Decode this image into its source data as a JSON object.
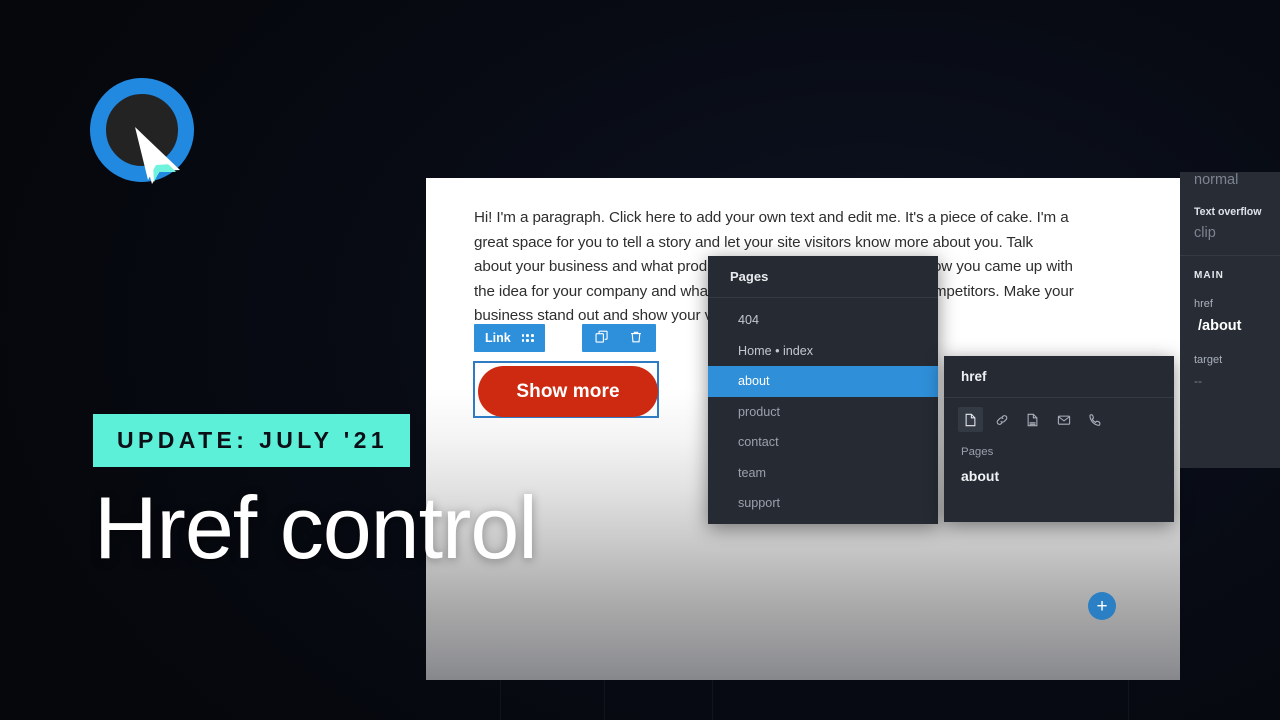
{
  "logo": {
    "name": "editor-x-logo"
  },
  "lower_third": {
    "badge": "UPDATE: JULY '21",
    "title": "Href control"
  },
  "canvas": {
    "paragraph": "Hi! I'm a paragraph. Click here to add your own text and edit me. It's a piece of cake. I'm a great space for you to tell a story and let your site visitors know more about you. Talk about your business and what products or services you offer. Share how you came up with the idea for your company and what makes you different from your competitors. Make your business stand out and show your visitors who you are.",
    "toolbar": {
      "link_label": "Link",
      "drag_handle": "drag-handle-icon",
      "duplicate_icon": "duplicate-icon",
      "delete_icon": "trash-icon"
    },
    "button": {
      "label": "Show more"
    },
    "add_button": {
      "label": "+"
    }
  },
  "pages_panel": {
    "title": "Pages",
    "items": [
      {
        "label": "404",
        "selected": false
      },
      {
        "label": "Home • index",
        "selected": false
      },
      {
        "label": "about",
        "selected": true
      },
      {
        "label": "product",
        "selected": false
      },
      {
        "label": "contact",
        "selected": false
      },
      {
        "label": "team",
        "selected": false
      },
      {
        "label": "support",
        "selected": false
      }
    ]
  },
  "href_panel": {
    "title": "href",
    "icons": [
      {
        "name": "page-icon",
        "active": true
      },
      {
        "name": "link-icon",
        "active": false
      },
      {
        "name": "file-download-icon",
        "active": false
      },
      {
        "name": "email-icon",
        "active": false
      },
      {
        "name": "phone-icon",
        "active": false
      }
    ],
    "field_label": "Pages",
    "field_value": "about"
  },
  "sidebar": {
    "white_space_value": "normal",
    "text_overflow_label": "Text overflow",
    "text_overflow_value": "clip",
    "section_title": "MAIN",
    "href_label": "href",
    "href_value": "/about",
    "target_label": "target",
    "target_value": "--"
  },
  "colors": {
    "background": "#080b14",
    "accent_blue": "#2f8fd8",
    "accent_mint": "#5df0d8",
    "button_red": "#ce2a12",
    "panel": "#262b33"
  }
}
